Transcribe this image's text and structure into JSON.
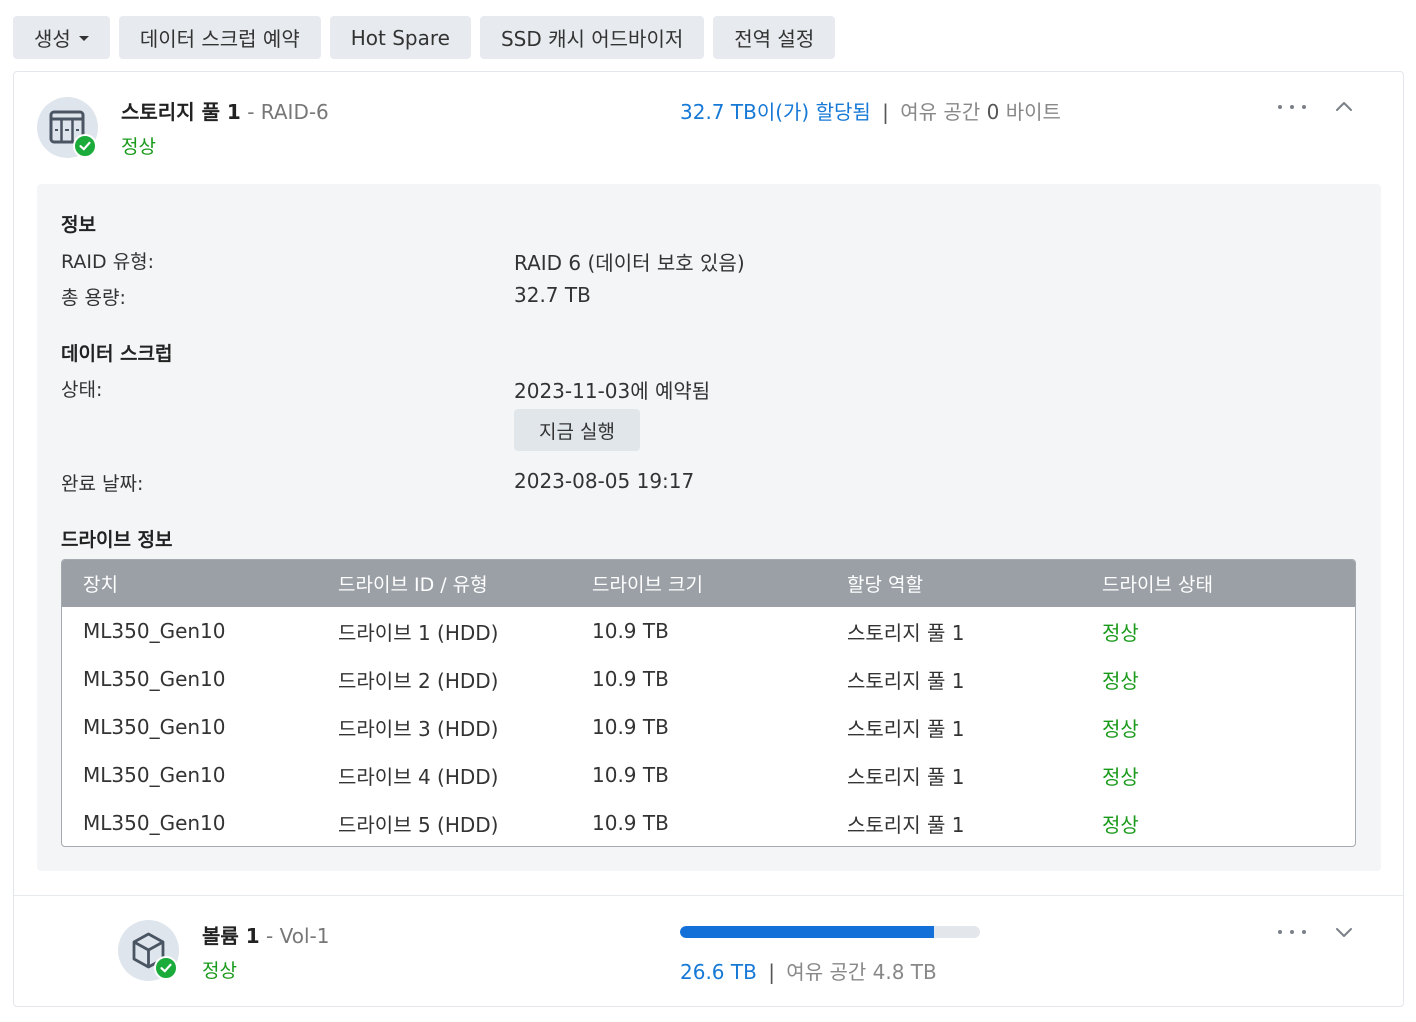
{
  "toolbar": {
    "create_label": "생성",
    "scrub_label": "데이터 스크럽 예약",
    "hotspare_label": "Hot Spare",
    "ssd_label": "SSD 캐시 어드바이저",
    "global_label": "전역 설정"
  },
  "pool": {
    "name": "스토리지 풀 1",
    "subtitle": "- RAID-6",
    "status": "정상",
    "allocated": "32.7 TB이(가) 할당됨",
    "separator": "|",
    "free_label": "여유 공간",
    "free_value": "0",
    "free_unit": "바이트"
  },
  "info": {
    "section_title": "정보",
    "raid_type_label": "RAID 유형:",
    "raid_type_value": "RAID 6 (데이터 보호 있음)",
    "capacity_label": "총 용량:",
    "capacity_value": "32.7 TB"
  },
  "scrub": {
    "section_title": "데이터 스크럽",
    "status_label": "상태:",
    "status_value": "2023-11-03에 예약됨",
    "run_now_label": "지금 실행",
    "completed_label": "완료 날짜:",
    "completed_value": "2023-08-05 19:17"
  },
  "drives": {
    "section_title": "드라이브 정보",
    "headers": [
      "장치",
      "드라이브 ID / 유형",
      "드라이브 크기",
      "할당 역할",
      "드라이브 상태"
    ],
    "rows": [
      {
        "device": "ML350_Gen10",
        "id": "드라이브 1 (HDD)",
        "size": "10.9 TB",
        "role": "스토리지 풀 1",
        "status": "정상"
      },
      {
        "device": "ML350_Gen10",
        "id": "드라이브 2 (HDD)",
        "size": "10.9 TB",
        "role": "스토리지 풀 1",
        "status": "정상"
      },
      {
        "device": "ML350_Gen10",
        "id": "드라이브 3 (HDD)",
        "size": "10.9 TB",
        "role": "스토리지 풀 1",
        "status": "정상"
      },
      {
        "device": "ML350_Gen10",
        "id": "드라이브 4 (HDD)",
        "size": "10.9 TB",
        "role": "스토리지 풀 1",
        "status": "정상"
      },
      {
        "device": "ML350_Gen10",
        "id": "드라이브 5 (HDD)",
        "size": "10.9 TB",
        "role": "스토리지 풀 1",
        "status": "정상"
      }
    ]
  },
  "volume": {
    "name": "볼륨 1",
    "subtitle": "- Vol-1",
    "status": "정상",
    "used": "26.6 TB",
    "separator": "|",
    "free": "여유 공간 4.8 TB",
    "usage_fraction": 0.847
  },
  "colors": {
    "accent": "#1779d6",
    "ok": "#1a9a1a",
    "bar": "#1470d9"
  }
}
